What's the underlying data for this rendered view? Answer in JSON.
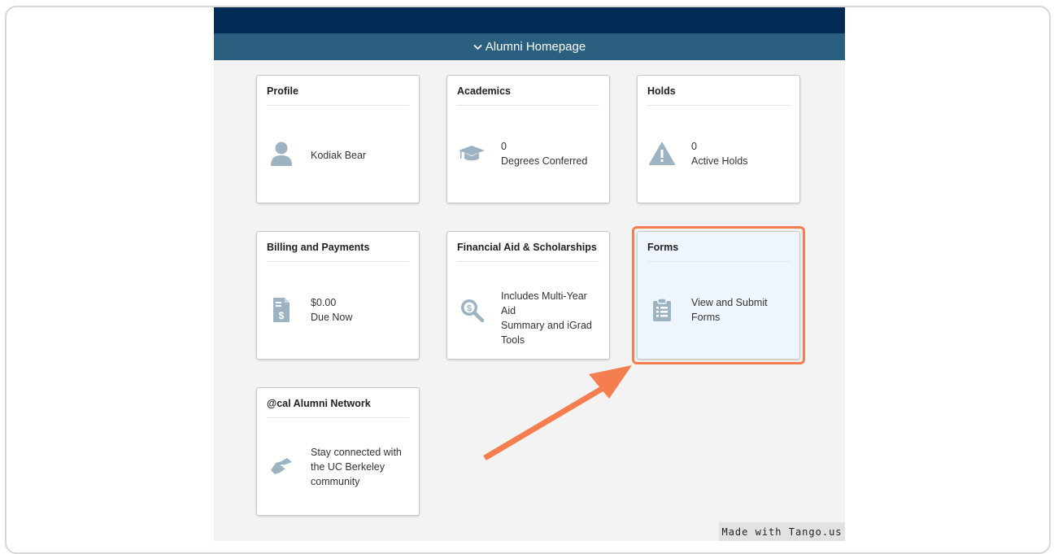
{
  "header": {
    "title": "Alumni Homepage",
    "chevron_icon": "chevron-down-icon"
  },
  "tiles": [
    {
      "id": "profile",
      "title": "Profile",
      "icon": "person-icon",
      "lines": [
        "Kodiak Bear"
      ]
    },
    {
      "id": "academics",
      "title": "Academics",
      "icon": "graduation-cap-icon",
      "lines": [
        "0",
        "Degrees Conferred"
      ]
    },
    {
      "id": "holds",
      "title": "Holds",
      "icon": "warning-icon",
      "lines": [
        "0",
        "Active Holds"
      ]
    },
    {
      "id": "billing",
      "title": "Billing and Payments",
      "icon": "invoice-icon",
      "lines": [
        "$0.00",
        "Due Now"
      ]
    },
    {
      "id": "financial-aid",
      "title": "Financial Aid & Scholarships",
      "icon": "money-search-icon",
      "lines": [
        "Includes Multi-Year Aid",
        "Summary and iGrad",
        "Tools"
      ]
    },
    {
      "id": "forms",
      "title": "Forms",
      "icon": "clipboard-icon",
      "lines": [
        "View and Submit",
        "Forms"
      ]
    },
    {
      "id": "alumni-network",
      "title": "@cal Alumni Network",
      "icon": "handshake-icon",
      "lines": [
        "Stay connected with",
        "the UC Berkeley",
        "community"
      ]
    }
  ],
  "watermark": "Made with Tango.us",
  "colors": {
    "top_bar": "#012b55",
    "sub_bar": "#2a5f7f",
    "icon_gray": "#9db3c2",
    "highlight": "#f47e50"
  }
}
